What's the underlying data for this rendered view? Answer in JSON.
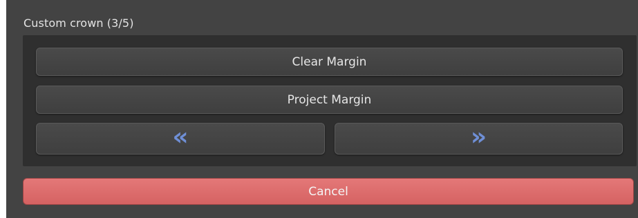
{
  "panel": {
    "title": "Custom crown (3/5)"
  },
  "buttons": {
    "clear_margin": "Clear Margin",
    "project_margin": "Project Margin",
    "prev_icon": "«",
    "next_icon": "»",
    "cancel": "Cancel"
  },
  "icons": {
    "prev": "double-chevron-left-icon",
    "next": "double-chevron-right-icon"
  },
  "colors": {
    "panel_background": "#434343",
    "group_background": "#2f2f2f",
    "nav_icon": "#6f8fd6",
    "cancel": "#dd6b6b"
  }
}
